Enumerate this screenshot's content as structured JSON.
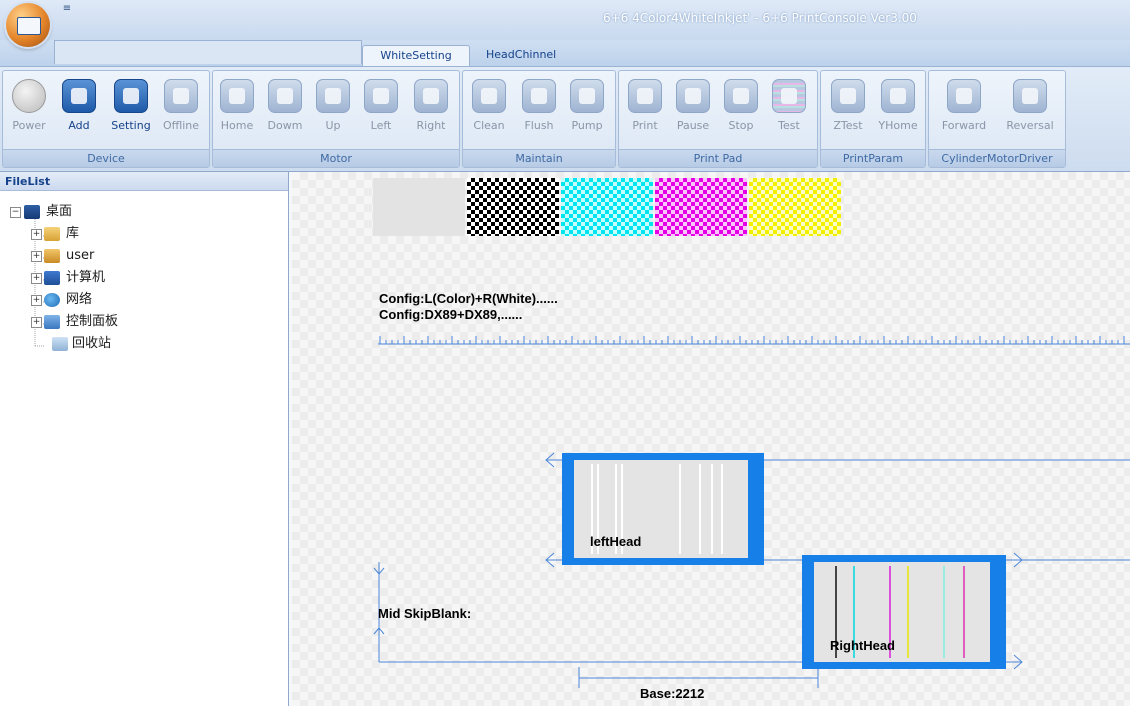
{
  "window": {
    "title": "6+6 4Color4WhiteInkjet' - 6+6 PrintConsole Ver3.00",
    "qa_dropdown": "≡"
  },
  "tabs": [
    "WhiteSetting",
    "HeadChinnel"
  ],
  "ribbon": {
    "groups": [
      {
        "label": "Device",
        "buttons": [
          "Power",
          "Add",
          "Setting",
          "Offline"
        ]
      },
      {
        "label": "Motor",
        "buttons": [
          "Home",
          "Dowm",
          "Up",
          "Left",
          "Right"
        ]
      },
      {
        "label": "Maintain",
        "buttons": [
          "Clean",
          "Flush",
          "Pump"
        ]
      },
      {
        "label": "Print Pad",
        "buttons": [
          "Print",
          "Pause",
          "Stop",
          "Test"
        ]
      },
      {
        "label": "PrintParam",
        "buttons": [
          "ZTest",
          "YHome"
        ]
      },
      {
        "label": "CylinderMotorDriver",
        "buttons": [
          "Forward",
          "Reversal"
        ]
      }
    ]
  },
  "filelist": {
    "header": "FileList",
    "tree": [
      {
        "label": "桌面",
        "icon": "desktop-icon"
      },
      {
        "label": "库",
        "icon": "library-icon"
      },
      {
        "label": "user",
        "icon": "user-folder-icon"
      },
      {
        "label": "计算机",
        "icon": "computer-icon"
      },
      {
        "label": "网络",
        "icon": "network-icon"
      },
      {
        "label": "控制面板",
        "icon": "control-panel-icon"
      },
      {
        "label": "回收站",
        "icon": "recycle-bin-icon"
      }
    ]
  },
  "canvas": {
    "config_line_1": "Config:L(Color)+R(White)......",
    "config_line_2": "Config:DX89+DX89,......",
    "left_head_label": "leftHead",
    "right_head_label": "RightHead",
    "mid_skip_label": "Mid SkipBlank:",
    "base_label": "Base:2212",
    "swatch_colors": [
      "#e3e3e3",
      "#000000",
      "#00e5ee",
      "#e600e6",
      "#f0f000"
    ],
    "accent_color": "#1680e8"
  }
}
